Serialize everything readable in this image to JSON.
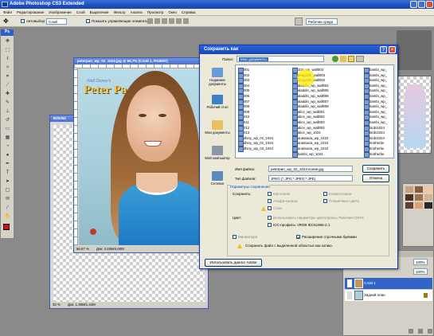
{
  "app": {
    "title": "Adobe Photoshop CS3 Extended"
  },
  "menu": [
    "Файл",
    "Редактирование",
    "Изображение",
    "Слой",
    "Выделение",
    "Фильтр",
    "Анализ",
    "Просмотр",
    "Окно",
    "Справка"
  ],
  "options_bar": {
    "autoselect_label": "Автовыбор:",
    "autoselect_value": "Слой",
    "transform_label": "Показать управляющие элементы",
    "workspace_label": "Рабочая среда"
  },
  "doc_main": {
    "title": "peterpan_wp_02_1024.jpg @ 66,7% (Слой 1, RGB/8#)",
    "logo_small": "Walt Disney's",
    "logo_big": "Peter Pa",
    "zoom": "66,67 %",
    "doc_info": "Док: 2,25M/4,00M"
  },
  "doc_back": {
    "title": "B20255",
    "zoom": "33 %",
    "doc_info": "Док: 1,36M/1,44M"
  },
  "dialog": {
    "title": "Сохранить как",
    "folder_label": "Папка:",
    "folder_value": "Мои документы",
    "places": [
      "Недавние документы",
      "Рабочий стол",
      "Мои документы",
      "Мой компьютер",
      "Сетевое"
    ],
    "files_col1": [
      "001",
      "002",
      "003",
      "004",
      "005",
      "006",
      "007",
      "008",
      "009",
      "010",
      "011",
      "012",
      "013"
    ],
    "files_col2": [
      "102_wp_wall003",
      "abugsilfe_wall003",
      "abugsilfe_wall002",
      "aladdin_wp_wall004",
      "aladdin_wp_wall005",
      "aladdin_wp_wall006",
      "aladdin_wp_wall007",
      "aladdin_wp_wall008",
      "alice_wp_wall001",
      "alice_wp_wall002",
      "alice_wp_wall003",
      "alice_wp_wall004",
      "alice_wp_1024",
      "anastacia_wp_1024",
      "anastacia_wp_1024",
      "anastacia_wp_1024",
      "bambi_wp_1024"
    ],
    "files_col3": [
      "bambi_wp_",
      "bambi_wp_",
      "bambi_wp_",
      "bambi_wp_",
      "bambi_wp_",
      "bambi_wp_",
      "bambi_wp_",
      "bambi_wp_",
      "bambi_wp_",
      "bambi_wp_",
      "bambi_wp_",
      "birds1024",
      "birds1024",
      "birds1024",
      "brotherbe",
      "brotherbe",
      "brotherbe"
    ],
    "files_col1b": [
      "dlsny_wp_01_1024",
      "dlsny_wp_01_1024",
      "dlsny_wp_02_1024"
    ],
    "filename_label": "Имя файла:",
    "filename_value": "peterpan_wp_02_1024 копия.jpg",
    "filetype_label": "Тип файлов:",
    "filetype_value": "JPEG (*.JPG;*.JPEG;*.JPE)",
    "save_button": "Сохранить",
    "cancel_button": "Отмена",
    "options_header": "Параметры сохранения",
    "save_label": "Сохранить:",
    "opt_copy": "Как копию",
    "opt_notes": "Комментарии",
    "opt_alpha": "Альфа-каналы",
    "opt_spot": "Плашечные цвета",
    "opt_layers": "Слои",
    "color_label": "Цвет:",
    "opt_proof": "Использовать параметры цветопробы: Рабочий CMYK",
    "opt_icc": "ICC-профиль: sRGB IEC61966-2.1",
    "opt_thumb": "Миниатюра",
    "opt_lower": "Расширение строчными буквами",
    "warning": "Сохранить файл с выделенной областью как копию.",
    "adobe_dialog_button": "Использовать диалог Adobe"
  },
  "layers": {
    "zoom1": "100%",
    "zoom2": "100%",
    "layer1": "Слой 1",
    "layer_bg": "Задний план"
  }
}
